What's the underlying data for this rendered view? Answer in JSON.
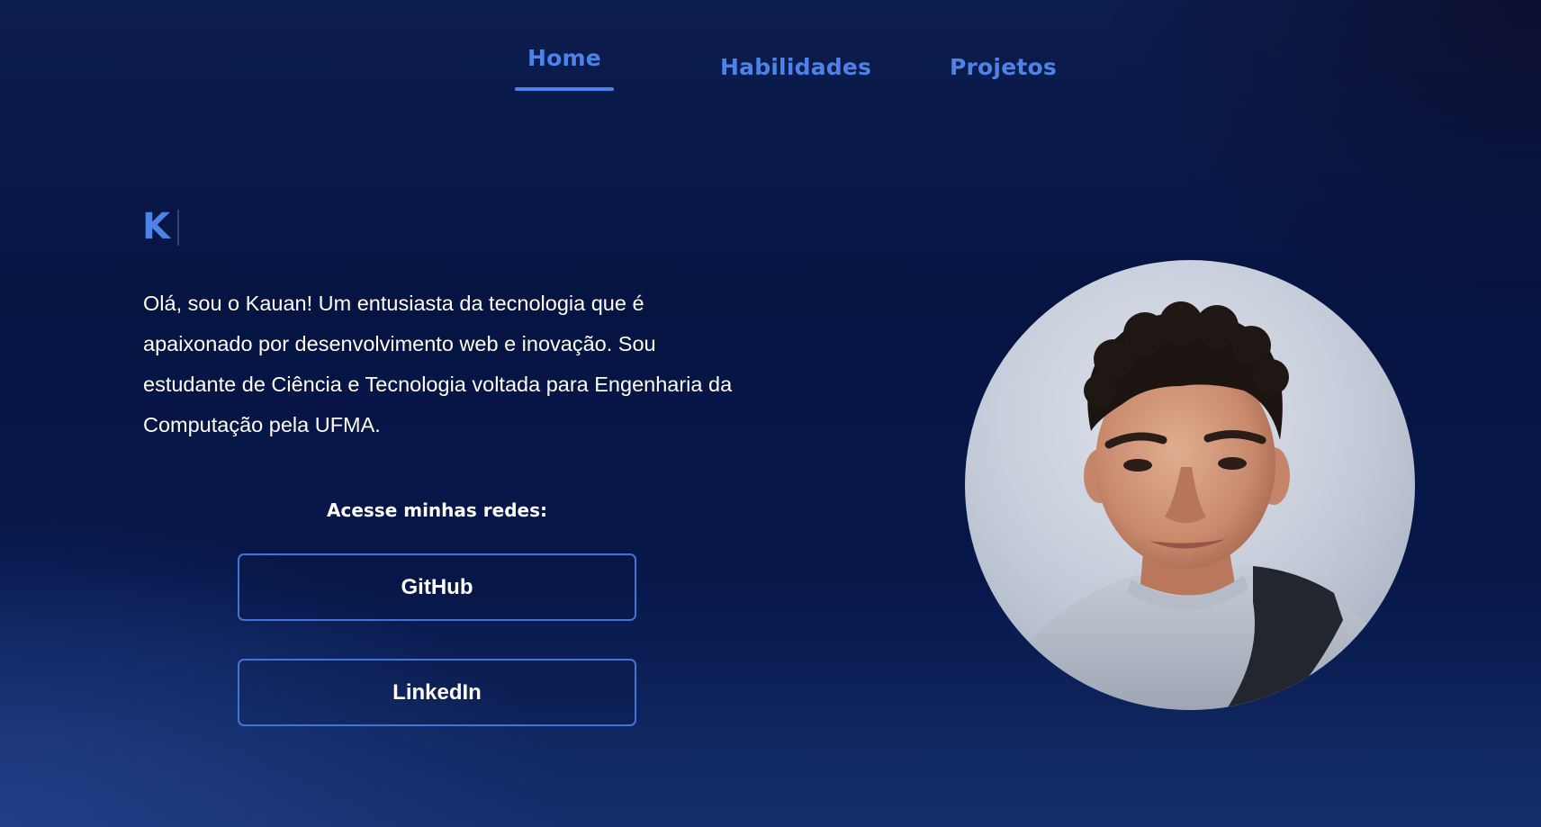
{
  "nav": {
    "items": [
      {
        "label": "Home",
        "active": true
      },
      {
        "label": "Habilidades",
        "active": false
      },
      {
        "label": "Projetos",
        "active": false
      }
    ]
  },
  "hero": {
    "typed_text": "K",
    "intro": "Olá, sou o Kauan! Um entusiasta da tecnologia que é apaixonado por desenvolvimento web e inovação. Sou estudante de Ciência e Tecnologia voltada para Engenharia da Computação pela UFMA.",
    "socials_title": "Acesse minhas redes:",
    "buttons": [
      {
        "label": "GitHub"
      },
      {
        "label": "LinkedIn"
      }
    ]
  },
  "colors": {
    "accent": "#4e82e6",
    "background": "#061442",
    "text": "#ffffff"
  }
}
